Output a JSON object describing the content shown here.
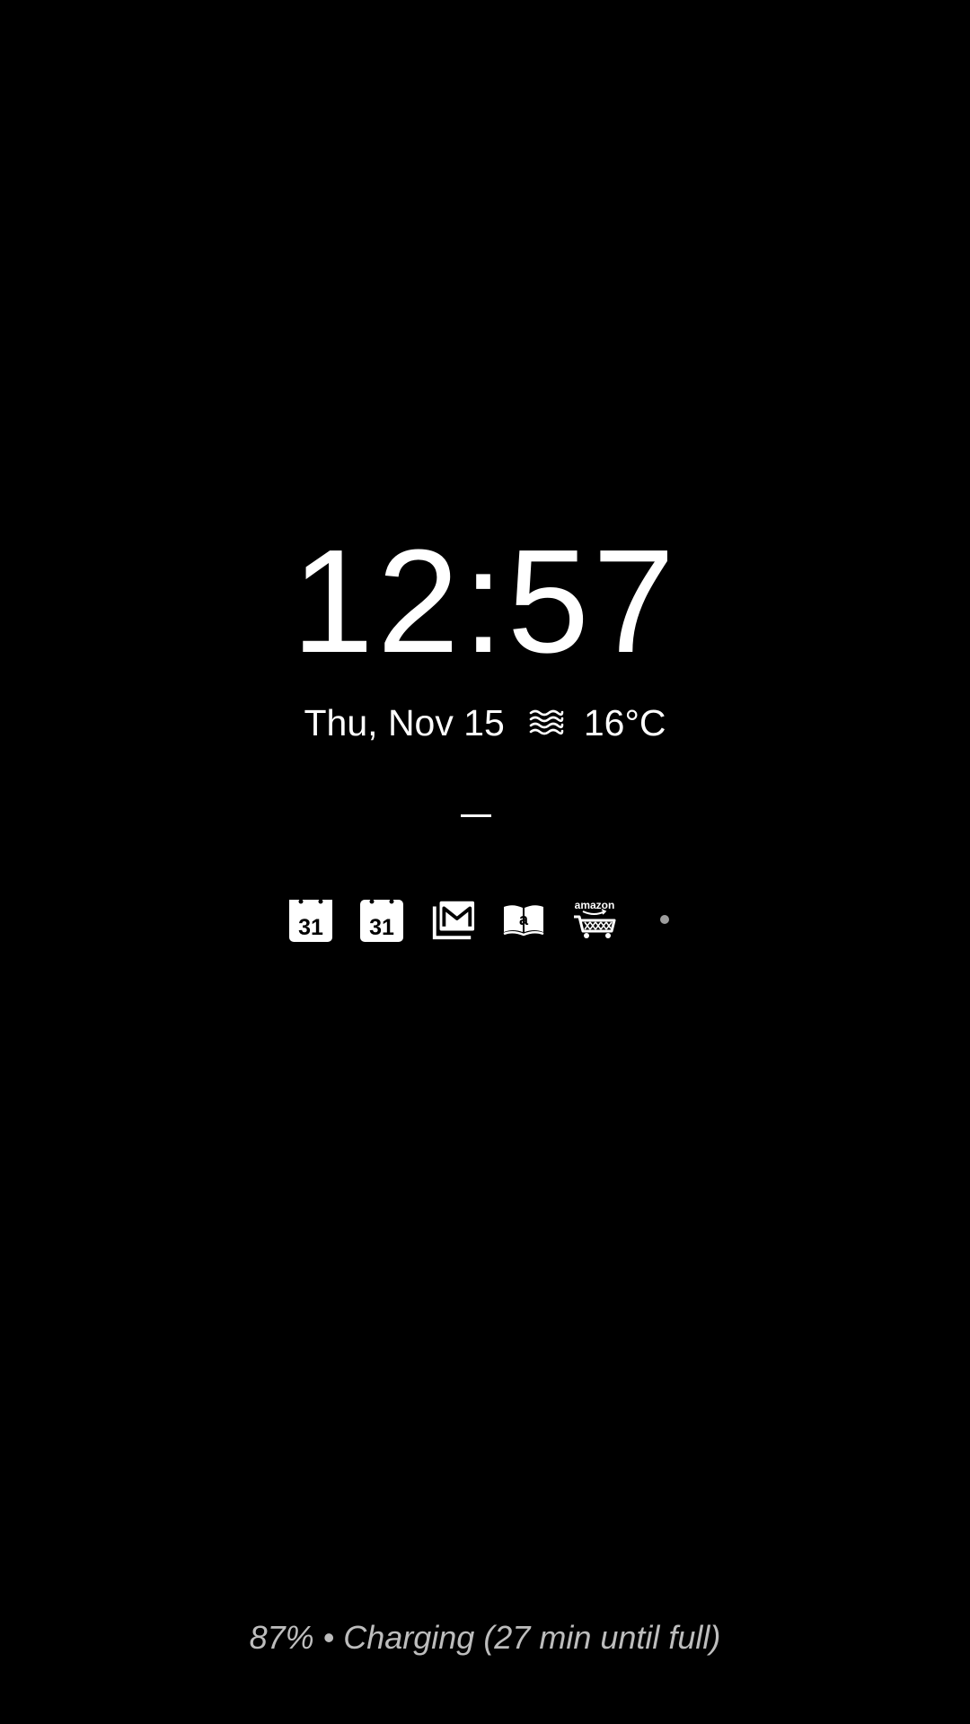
{
  "lockscreen": {
    "time": "12:57",
    "date": "Thu, Nov 15",
    "weather": {
      "icon": "haze-icon",
      "temperature": "16°C"
    },
    "notification_icons": [
      {
        "icon": "calendar-icon",
        "label": "31"
      },
      {
        "icon": "calendar-icon",
        "label": "31"
      },
      {
        "icon": "gmail-icon"
      },
      {
        "icon": "amazon-kindle-icon",
        "label": "a"
      },
      {
        "icon": "amazon-shopping-icon",
        "label": "amazon"
      }
    ],
    "charging_status": "87% • Charging (27 min until full)"
  },
  "colors": {
    "background": "#000000",
    "foreground": "#ffffff",
    "muted": "#bdbdbd",
    "dot": "#9e9e9e"
  }
}
